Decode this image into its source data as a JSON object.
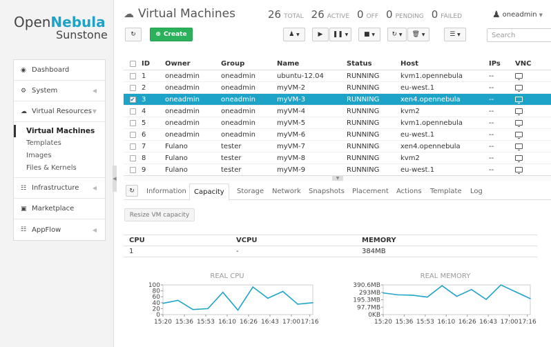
{
  "logo": {
    "line1_a": "Open",
    "line1_b": "Nebula",
    "line2": "Sunstone"
  },
  "sidebar": {
    "items": [
      {
        "label": "Dashboard",
        "icon": "dashboard-icon"
      },
      {
        "label": "System",
        "icon": "cogs-icon"
      },
      {
        "label": "Virtual Resources",
        "icon": "cloud-icon"
      },
      {
        "label": "Infrastructure",
        "icon": "sitemap-icon"
      },
      {
        "label": "Marketplace",
        "icon": "cart-icon"
      },
      {
        "label": "AppFlow",
        "icon": "sitemap-icon"
      }
    ],
    "sub": [
      "Virtual Machines",
      "Templates",
      "Images",
      "Files & Kernels"
    ]
  },
  "header": {
    "title": "Virtual Machines",
    "stats": [
      {
        "n": "26",
        "t": "TOTAL"
      },
      {
        "n": "26",
        "t": "ACTIVE"
      },
      {
        "n": "0",
        "t": "OFF"
      },
      {
        "n": "0",
        "t": "PENDING"
      },
      {
        "n": "0",
        "t": "FAILED"
      }
    ],
    "user": "oneadmin"
  },
  "toolbar": {
    "create_label": "Create",
    "search_placeholder": "Search"
  },
  "table": {
    "columns": [
      "ID",
      "Owner",
      "Group",
      "Name",
      "Status",
      "Host",
      "IPs",
      "VNC"
    ],
    "rows": [
      {
        "id": "1",
        "owner": "oneadmin",
        "group": "oneadmin",
        "name": "ubuntu-12.04",
        "status": "RUNNING",
        "host": "kvm1.opennebula",
        "ips": "--"
      },
      {
        "id": "2",
        "owner": "oneadmin",
        "group": "oneadmin",
        "name": "myVM-2",
        "status": "RUNNING",
        "host": "eu-west.1",
        "ips": "--"
      },
      {
        "id": "3",
        "owner": "oneadmin",
        "group": "oneadmin",
        "name": "myVM-3",
        "status": "RUNNING",
        "host": "xen4.opennebula",
        "ips": "--",
        "selected": true
      },
      {
        "id": "4",
        "owner": "oneadmin",
        "group": "oneadmin",
        "name": "myVM-4",
        "status": "RUNNING",
        "host": "kvm2",
        "ips": "--"
      },
      {
        "id": "5",
        "owner": "oneadmin",
        "group": "oneadmin",
        "name": "myVM-5",
        "status": "RUNNING",
        "host": "kvm1.opennebula",
        "ips": "--"
      },
      {
        "id": "6",
        "owner": "oneadmin",
        "group": "oneadmin",
        "name": "myVM-6",
        "status": "RUNNING",
        "host": "eu-west.1",
        "ips": "--"
      },
      {
        "id": "7",
        "owner": "Fulano",
        "group": "tester",
        "name": "myVM-7",
        "status": "RUNNING",
        "host": "xen4.opennebula",
        "ips": "--"
      },
      {
        "id": "8",
        "owner": "Fulano",
        "group": "tester",
        "name": "myVM-8",
        "status": "RUNNING",
        "host": "kvm2",
        "ips": "--"
      },
      {
        "id": "9",
        "owner": "Fulano",
        "group": "tester",
        "name": "myVM-9",
        "status": "RUNNING",
        "host": "eu-west.1",
        "ips": "--"
      }
    ]
  },
  "tabs": [
    "Information",
    "Capacity",
    "Storage",
    "Network",
    "Snapshots",
    "Placement",
    "Actions",
    "Template",
    "Log"
  ],
  "active_tab": "Capacity",
  "capacity": {
    "resize_label": "Resize VM capacity",
    "headers": [
      "CPU",
      "VCPU",
      "MEMORY"
    ],
    "values": [
      "1",
      "-",
      "384MB"
    ]
  },
  "accent_color": "#1ea3c8",
  "chart_data": [
    {
      "type": "line",
      "title": "REAL CPU",
      "x": [
        "15:20",
        "15:36",
        "15:53",
        "16:10",
        "16:26",
        "16:43",
        "17:00",
        "17:16"
      ],
      "y_ticks": [
        "0",
        "20",
        "40",
        "60",
        "80",
        "100"
      ],
      "ylim": [
        0,
        100
      ],
      "series": [
        {
          "values": [
            38,
            48,
            17,
            20,
            75,
            15,
            93,
            55,
            78,
            35,
            40
          ]
        }
      ]
    },
    {
      "type": "line",
      "title": "REAL MEMORY",
      "x": [
        "15:20",
        "15:36",
        "15:53",
        "16:10",
        "16:26",
        "16:43",
        "17:00",
        "17:16"
      ],
      "y_ticks": [
        "0KB",
        "97.7MB",
        "195.3MB",
        "293MB",
        "390.6MB"
      ],
      "ylim": [
        0,
        390.6
      ],
      "series": [
        {
          "values": [
            285,
            260,
            255,
            230,
            380,
            240,
            330,
            200,
            390,
            300,
            210
          ]
        }
      ]
    }
  ]
}
